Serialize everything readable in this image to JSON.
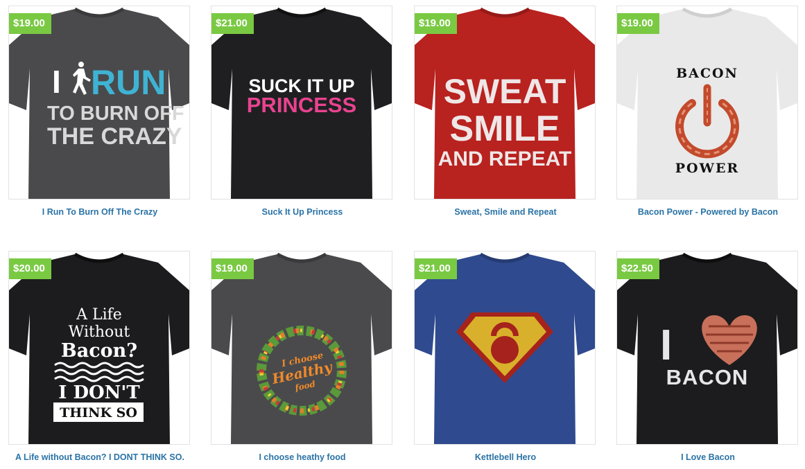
{
  "products": [
    {
      "price": "$19.00",
      "title": "I Run To Burn Off The Crazy",
      "shirt_color": "#4a4a4c",
      "design": {
        "i": "I",
        "run": "RUN",
        "line2": "TO BURN OFF",
        "line3": "THE CRAZY"
      }
    },
    {
      "price": "$21.00",
      "title": "Suck It Up Princess",
      "shirt_color": "#1f1f21",
      "design": {
        "line1": "SUCK IT UP",
        "line2": "PRINCESS"
      }
    },
    {
      "price": "$19.00",
      "title": "Sweat, Smile and Repeat",
      "shirt_color": "#b8221f",
      "design": {
        "line1": "SWEAT",
        "line2": "SMILE",
        "line3": "AND REPEAT"
      }
    },
    {
      "price": "$19.00",
      "title": "Bacon Power - Powered by Bacon",
      "shirt_color": "#e9e9e9",
      "design": {
        "line1": "BACON",
        "line2": "POWER"
      }
    },
    {
      "price": "$20.00",
      "title": "A Life without Bacon? I DONT THINK SO.",
      "shirt_color": "#1c1c1e",
      "design": {
        "line1": "A Life",
        "line2": "Without",
        "line3": "Bacon?",
        "line4": "I DON'T",
        "line5": "THINK SO"
      }
    },
    {
      "price": "$19.00",
      "title": "I choose heathy food",
      "shirt_color": "#4a4a4c",
      "design": {
        "line1": "I choose",
        "line2": "Healthy",
        "line3": "food"
      }
    },
    {
      "price": "$21.00",
      "title": "Kettlebell Hero",
      "shirt_color": "#2f4a8e",
      "design": {}
    },
    {
      "price": "$22.50",
      "title": "I Love Bacon",
      "shirt_color": "#1c1c1e",
      "design": {
        "line1": "I",
        "line2": "BACON"
      }
    }
  ]
}
